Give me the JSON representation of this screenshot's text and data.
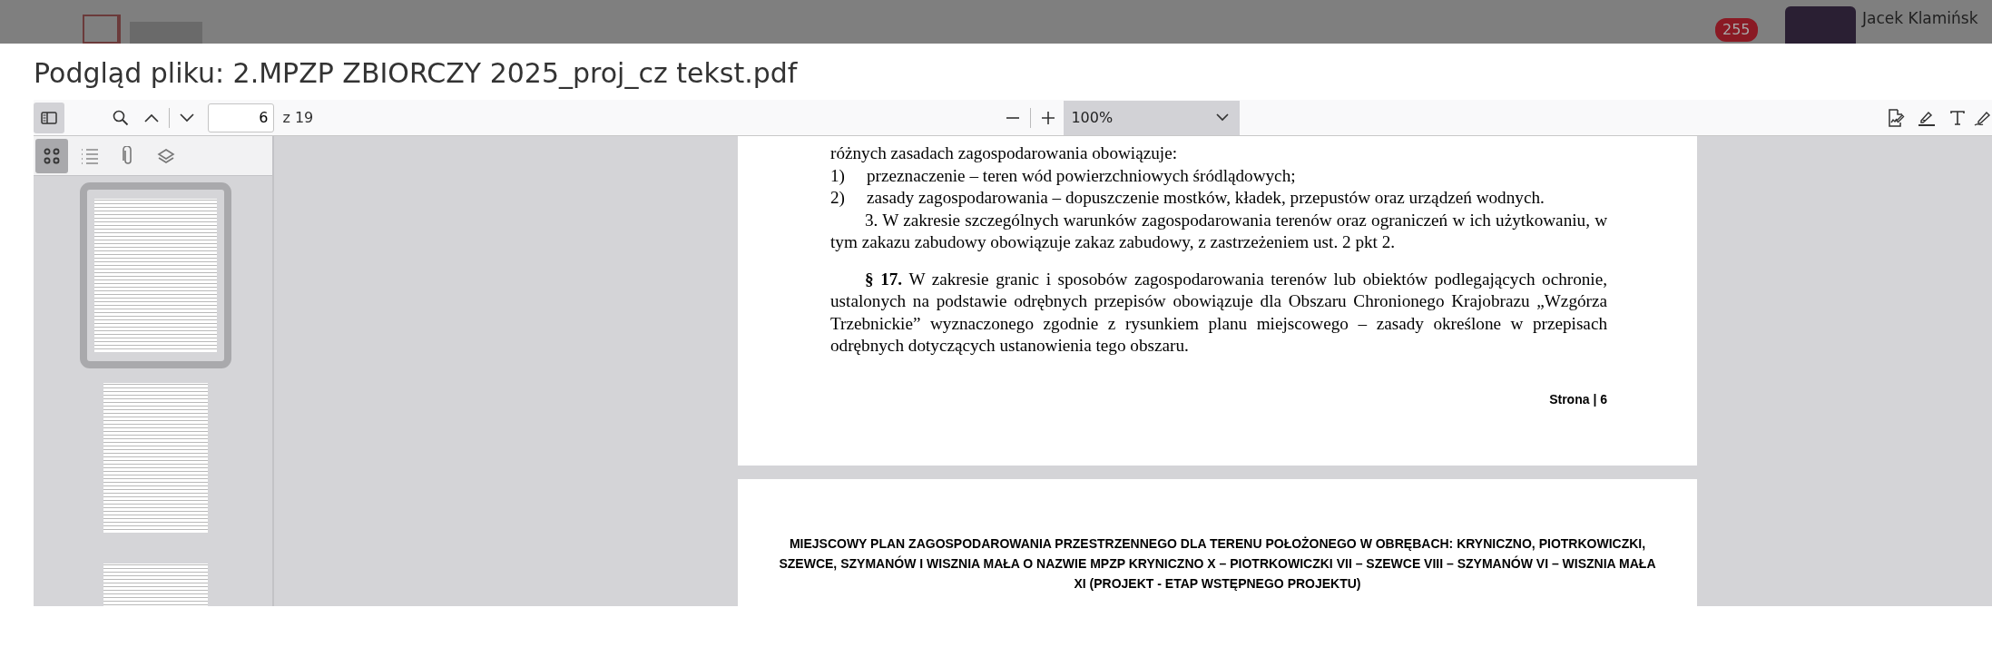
{
  "app_header": {
    "notification_count": "255",
    "user_name": "Jacek Klamińsk"
  },
  "modal": {
    "title": "Podgląd pliku: 2.MPZP ZBIORCZY 2025_proj_cz tekst.pdf"
  },
  "toolbar": {
    "sidebar_toggle": {
      "selected": true
    },
    "page_input": {
      "value": "6"
    },
    "page_total": "z 19",
    "zoom": "100%"
  },
  "sidebar_tabs": [
    {
      "kind": "thumbnails",
      "selected": true
    },
    {
      "kind": "outline",
      "selected": false
    },
    {
      "kind": "attachments",
      "selected": false
    },
    {
      "kind": "layers",
      "selected": false
    }
  ],
  "thumbnails": [
    {
      "selected": true
    },
    {
      "selected": false
    },
    {
      "selected": false
    }
  ],
  "pages": [
    {
      "paragraphs": [
        {
          "kind": "text",
          "text": "różnych zasadach zagospodarowania obowiązuje:"
        },
        {
          "kind": "list_item",
          "number": "1)",
          "text": "przeznaczenie – teren wód powierzchniowych śródlądowych;"
        },
        {
          "kind": "list_item",
          "number": "2)",
          "text": "zasady zagospodarowania – dopuszczenie mostków, kładek, przepustów oraz urządzeń wodnych."
        },
        {
          "kind": "indent",
          "text": "3.  W zakresie szczególnych warunków zagospodarowania terenów oraz ograniczeń w ich użytkowaniu, w tym zakazu zabudowy obowiązuje zakaz zabudowy, z zastrzeżeniem ust. 2 pkt 2."
        },
        {
          "kind": "section",
          "text": "**§ 17.** W zakresie granic i sposobów zagospodarowania terenów lub obiektów podlegających ochronie, ustalonych na podstawie odrębnych przepisów obowiązuje dla Obszaru Chronionego Krajobrazu „Wzgórza Trzebnickie” wyznaczonego zgodnie z rysunkiem planu miejscowego – zasady określone w przepisach odrębnych dotyczących ustanowienia tego obszaru."
        }
      ],
      "footer": "Strona | 6"
    },
    {
      "header": "MIEJSCOWY PLAN ZAGOSPODAROWANIA PRZESTRZENNEGO DLA TERENU POŁOŻONEGO W OBRĘBACH: KRYNICZNO, PIOTRKOWICZKI, SZEWCE, SZYMANÓW I WISZNIA MAŁA O NAZWIE MPZP KRYNICZNO X – PIOTRKOWICZKI VII – SZEWCE VIII – SZYMANÓW VI – WISZNIA MAŁA XI (PROJEKT - ETAP WSTĘPNEGO PROJEKTU)"
    }
  ]
}
